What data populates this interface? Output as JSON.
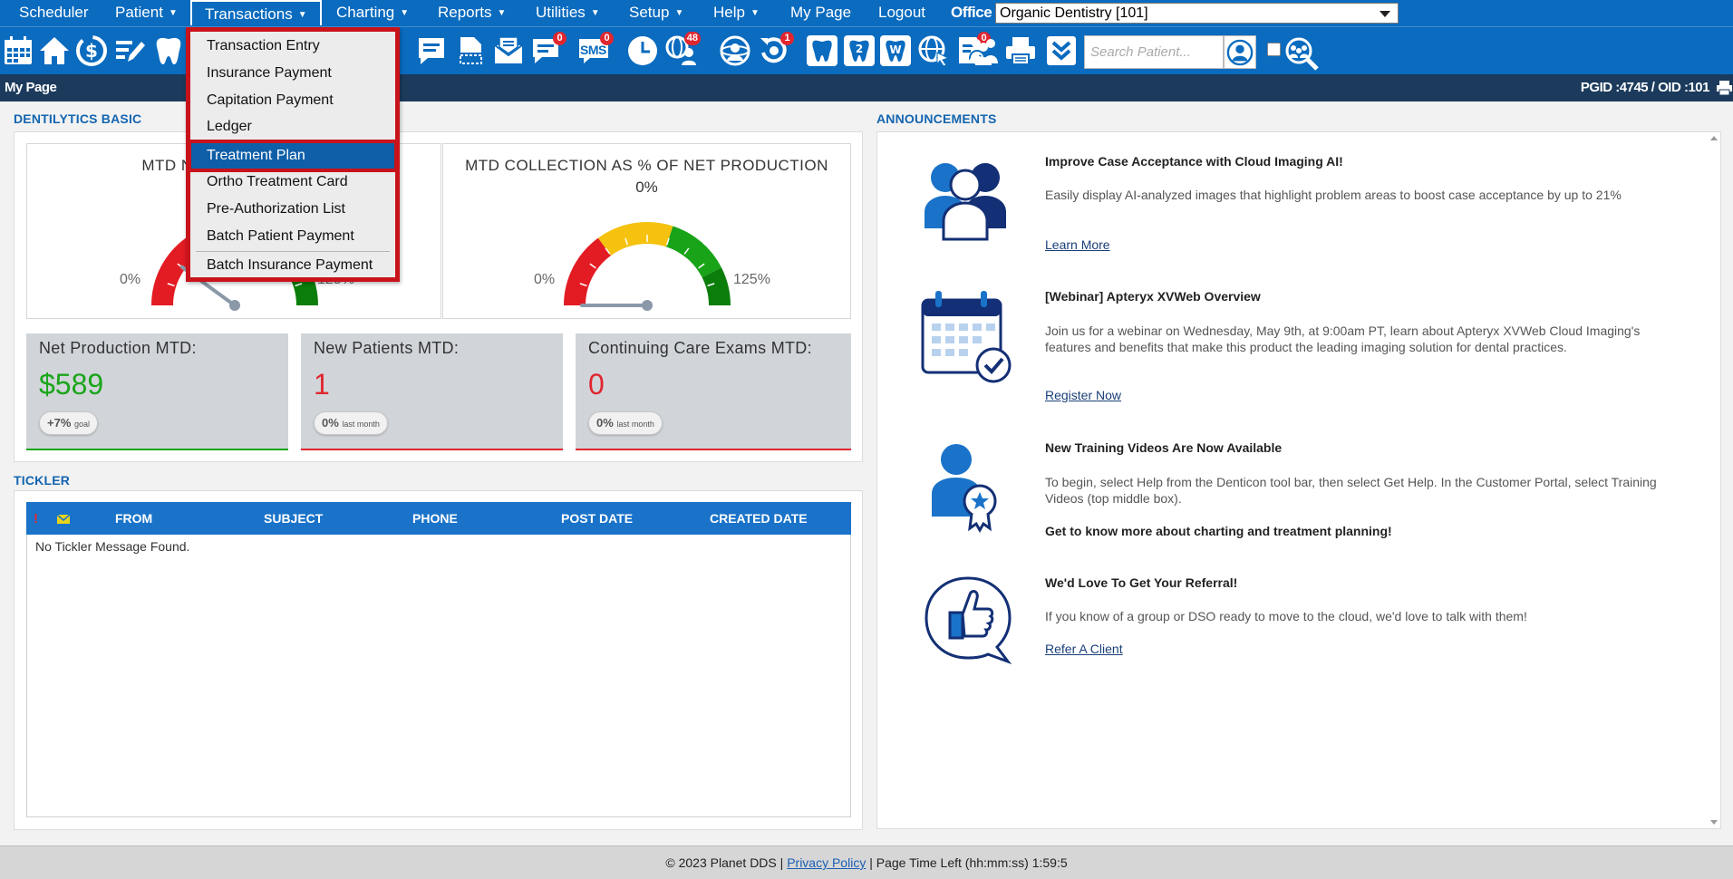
{
  "menu": {
    "items": [
      {
        "label": "Scheduler",
        "caret": false
      },
      {
        "label": "Patient",
        "caret": true
      },
      {
        "label": "Transactions",
        "caret": true
      },
      {
        "label": "Charting",
        "caret": true
      },
      {
        "label": "Reports",
        "caret": true
      },
      {
        "label": "Utilities",
        "caret": true
      },
      {
        "label": "Setup",
        "caret": true
      },
      {
        "label": "Help",
        "caret": true
      },
      {
        "label": "My Page",
        "caret": false
      },
      {
        "label": "Logout",
        "caret": false
      }
    ],
    "caret_glyph": "▼",
    "office_label": "Office",
    "office_value": "Organic Dentistry [101]"
  },
  "toolbar": {
    "icons": [
      "calendar-icon",
      "home-icon",
      "dollar-icon",
      "pencil-list-icon",
      "tooth-icon",
      "phone-icon",
      "camera-icon",
      "scissors-icon",
      "document-icon",
      "tasks-icon",
      "search-doc-icon",
      "chat-icon",
      "file-icon",
      "envelope-icon",
      "message-icon",
      "sms-icon",
      "clock-icon",
      "globe-people-icon",
      "support-icon",
      "recall-icon",
      "tooth-chart-icon",
      "tooth-2-icon",
      "tooth-w-icon",
      "globe-cursor-icon",
      "checklist-icon",
      "team-icon",
      "printer-icon",
      "chevron-down-icon"
    ],
    "badges": {
      "message": "0",
      "sms": "0",
      "globe_people": "48",
      "recall": "1",
      "checklist": "0"
    },
    "sms_text": "SMS",
    "search_placeholder": "Search Patient..."
  },
  "header": {
    "title": "My Page",
    "ids": "PGID :4745  /  OID :101"
  },
  "dentilytics": {
    "section_title": "DENTILYTICS BASIC",
    "gauge1": {
      "title": "MTD NET PRODUCTION",
      "value_text": "",
      "min": "0%",
      "max": "125%",
      "percent": 25
    },
    "gauge2": {
      "title": "MTD COLLECTION AS % OF NET PRODUCTION",
      "value_text": "0%",
      "min": "0%",
      "max": "125%",
      "percent": 0
    },
    "kpis": [
      {
        "title": "Net Production MTD:",
        "value": "$589",
        "pill_main": "+7%",
        "pill_sub": "goal",
        "color": "#1aa51a"
      },
      {
        "title": "New Patients MTD:",
        "value": "1",
        "pill_main": "0%",
        "pill_sub": "last month",
        "color": "#e0262f"
      },
      {
        "title": "Continuing Care Exams MTD:",
        "value": "0",
        "pill_main": "0%",
        "pill_sub": "last month",
        "color": "#e0262f"
      }
    ]
  },
  "tickler": {
    "section_title": "TICKLER",
    "columns": [
      "FROM",
      "SUBJECT",
      "PHONE",
      "POST DATE",
      "CREATED DATE"
    ],
    "flag_glyph": "!",
    "empty_message": "No Tickler Message Found."
  },
  "announcements": {
    "section_title": "ANNOUNCEMENTS",
    "items": [
      {
        "title": "Improve Case Acceptance with Cloud Imaging AI!",
        "body": "Easily display AI-analyzed images that highlight problem areas to boost case acceptance by up to 21%",
        "link": "Learn More"
      },
      {
        "title": "[Webinar] Apteryx XVWeb Overview",
        "body": "Join us for a webinar on Wednesday, May 9th, at 9:00am PT, learn about Apteryx XVWeb Cloud Imaging's features and benefits that make this product the leading imaging solution for dental practices.",
        "link": "Register Now"
      },
      {
        "title": "New Training Videos Are Now Available",
        "body": "To begin, select Help from the Denticon tool bar, then select Get Help. In the Customer Portal, select Training Videos (top middle box).",
        "bold_line": "Get to know more about charting and treatment planning!"
      },
      {
        "title": "We'd Love To Get Your Referral!",
        "body": "If you know of a group or DSO ready to move to the cloud, we'd love to talk with them!",
        "link": "Refer A Client"
      }
    ]
  },
  "footer": {
    "copyright": "© 2023 Planet DDS |",
    "privacy": "Privacy Policy",
    "time_left": "|  Page Time Left (hh:mm:ss) 1:59:5"
  },
  "transactions_menu": {
    "items": [
      "Transaction Entry",
      "Insurance Payment",
      "Capitation Payment",
      "Ledger",
      "Treatment Plan",
      "Ortho Treatment Card",
      "Pre-Authorization List",
      "Batch Patient Payment",
      "Batch Insurance Payment"
    ],
    "highlighted": "Treatment Plan"
  },
  "colors": {
    "brand": "#0a6bbf",
    "header": "#1b3a5c",
    "accent": "#1465b0",
    "highlight_border": "#c8131b"
  }
}
